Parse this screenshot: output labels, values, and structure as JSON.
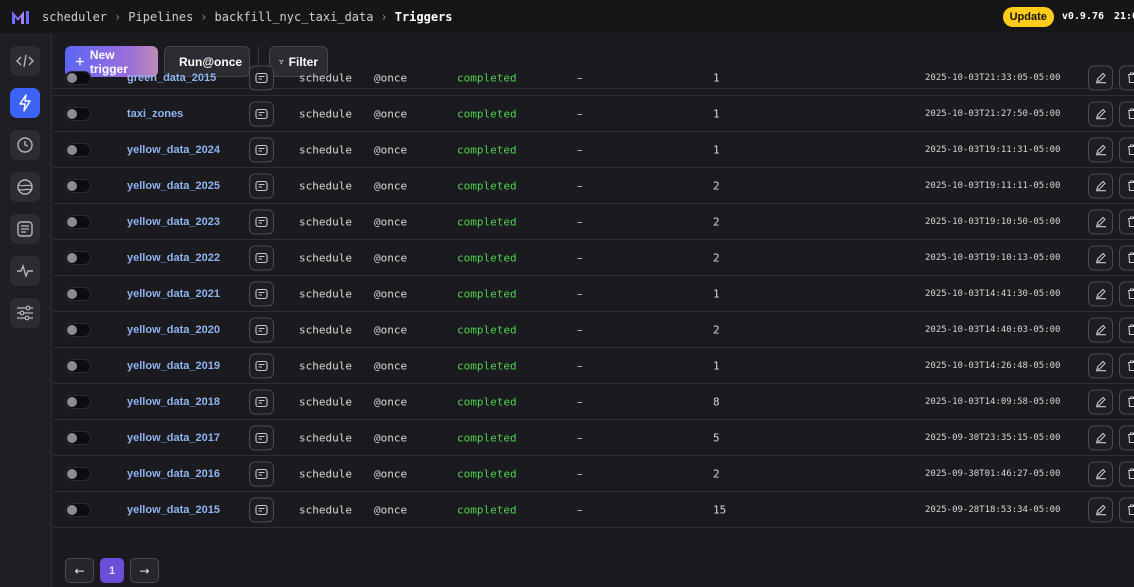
{
  "header": {
    "breadcrumbs": [
      "scheduler",
      "Pipelines",
      "backfill_nyc_taxi_data",
      "Triggers"
    ],
    "update_label": "Update",
    "version": "v0.9.76",
    "clock": "21:0"
  },
  "toolbar": {
    "new_trigger_label": "New trigger",
    "run_once_label": "Run@once",
    "filter_label": "Filter"
  },
  "triggers": [
    {
      "name": "green_data_2015",
      "type": "schedule",
      "frequency": "@once",
      "status": "completed",
      "dash": "–",
      "runs": "1",
      "timestamp": "2025-10-03T21:33:05-05:00"
    },
    {
      "name": "taxi_zones",
      "type": "schedule",
      "frequency": "@once",
      "status": "completed",
      "dash": "–",
      "runs": "1",
      "timestamp": "2025-10-03T21:27:50-05:00"
    },
    {
      "name": "yellow_data_2024",
      "type": "schedule",
      "frequency": "@once",
      "status": "completed",
      "dash": "–",
      "runs": "1",
      "timestamp": "2025-10-03T19:11:31-05:00"
    },
    {
      "name": "yellow_data_2025",
      "type": "schedule",
      "frequency": "@once",
      "status": "completed",
      "dash": "–",
      "runs": "2",
      "timestamp": "2025-10-03T19:11:11-05:00"
    },
    {
      "name": "yellow_data_2023",
      "type": "schedule",
      "frequency": "@once",
      "status": "completed",
      "dash": "–",
      "runs": "2",
      "timestamp": "2025-10-03T19:10:50-05:00"
    },
    {
      "name": "yellow_data_2022",
      "type": "schedule",
      "frequency": "@once",
      "status": "completed",
      "dash": "–",
      "runs": "2",
      "timestamp": "2025-10-03T19:10:13-05:00"
    },
    {
      "name": "yellow_data_2021",
      "type": "schedule",
      "frequency": "@once",
      "status": "completed",
      "dash": "–",
      "runs": "1",
      "timestamp": "2025-10-03T14:41:30-05:00"
    },
    {
      "name": "yellow_data_2020",
      "type": "schedule",
      "frequency": "@once",
      "status": "completed",
      "dash": "–",
      "runs": "2",
      "timestamp": "2025-10-03T14:40:03-05:00"
    },
    {
      "name": "yellow_data_2019",
      "type": "schedule",
      "frequency": "@once",
      "status": "completed",
      "dash": "–",
      "runs": "1",
      "timestamp": "2025-10-03T14:26:48-05:00"
    },
    {
      "name": "yellow_data_2018",
      "type": "schedule",
      "frequency": "@once",
      "status": "completed",
      "dash": "–",
      "runs": "8",
      "timestamp": "2025-10-03T14:09:58-05:00"
    },
    {
      "name": "yellow_data_2017",
      "type": "schedule",
      "frequency": "@once",
      "status": "completed",
      "dash": "–",
      "runs": "5",
      "timestamp": "2025-09-30T23:35:15-05:00"
    },
    {
      "name": "yellow_data_2016",
      "type": "schedule",
      "frequency": "@once",
      "status": "completed",
      "dash": "–",
      "runs": "2",
      "timestamp": "2025-09-30T01:46:27-05:00"
    },
    {
      "name": "yellow_data_2015",
      "type": "schedule",
      "frequency": "@once",
      "status": "completed",
      "dash": "–",
      "runs": "15",
      "timestamp": "2025-09-28T18:53:34-05:00"
    }
  ],
  "pagination": {
    "prev": "←",
    "current_page": "1",
    "next": "→"
  },
  "colors": {
    "accent": "#3b63f5",
    "status_completed": "#4fd14f",
    "update_badge": "#ffcc19",
    "trigger_name": "#8fb4f0"
  }
}
